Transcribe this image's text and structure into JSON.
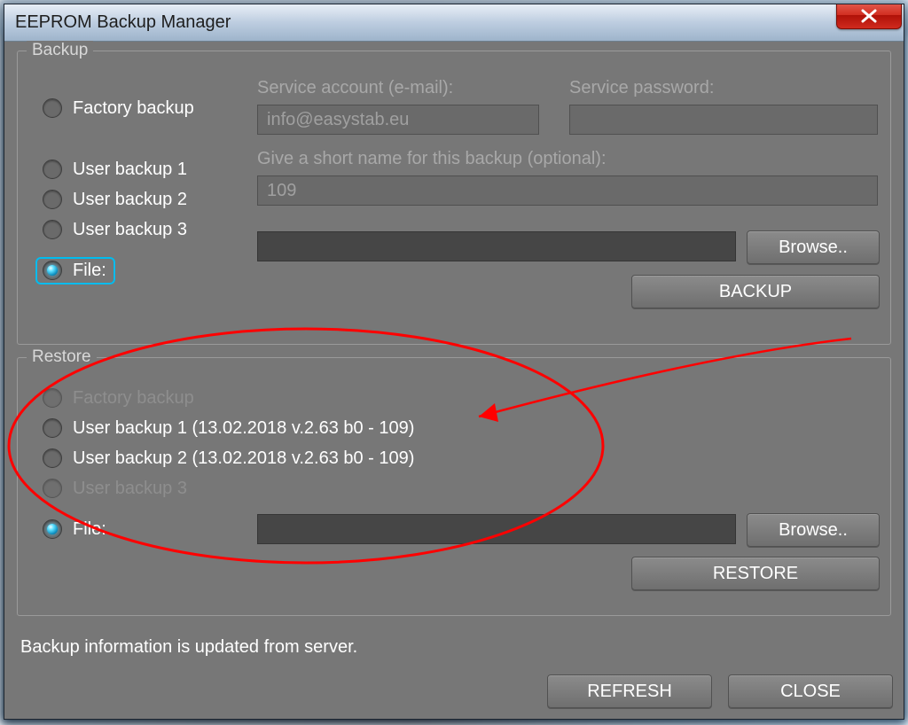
{
  "window": {
    "title": "EEPROM Backup Manager"
  },
  "backup": {
    "group_title": "Backup",
    "radios": {
      "factory": "Factory backup",
      "user1": "User backup 1",
      "user2": "User backup 2",
      "user3": "User backup 3",
      "file": "File:"
    },
    "service_account_label": "Service account (e-mail):",
    "service_account_value": "info@easystab.eu",
    "service_password_label": "Service password:",
    "service_password_value": "",
    "short_name_label": "Give a  short name for this backup (optional):",
    "short_name_value": "109",
    "file_path_value": "",
    "browse_label": "Browse..",
    "backup_button": "BACKUP"
  },
  "restore": {
    "group_title": "Restore",
    "radios": {
      "factory": "Factory backup",
      "user1": "User backup 1 (13.02.2018 v.2.63 b0 - 109)",
      "user2": "User backup 2 (13.02.2018 v.2.63 b0 - 109)",
      "user3": "User backup 3",
      "file": "File:"
    },
    "file_path_value": "",
    "browse_label": "Browse..",
    "restore_button": "RESTORE"
  },
  "status": "Backup information is updated from server.",
  "buttons": {
    "refresh": "REFRESH",
    "close": "CLOSE"
  }
}
